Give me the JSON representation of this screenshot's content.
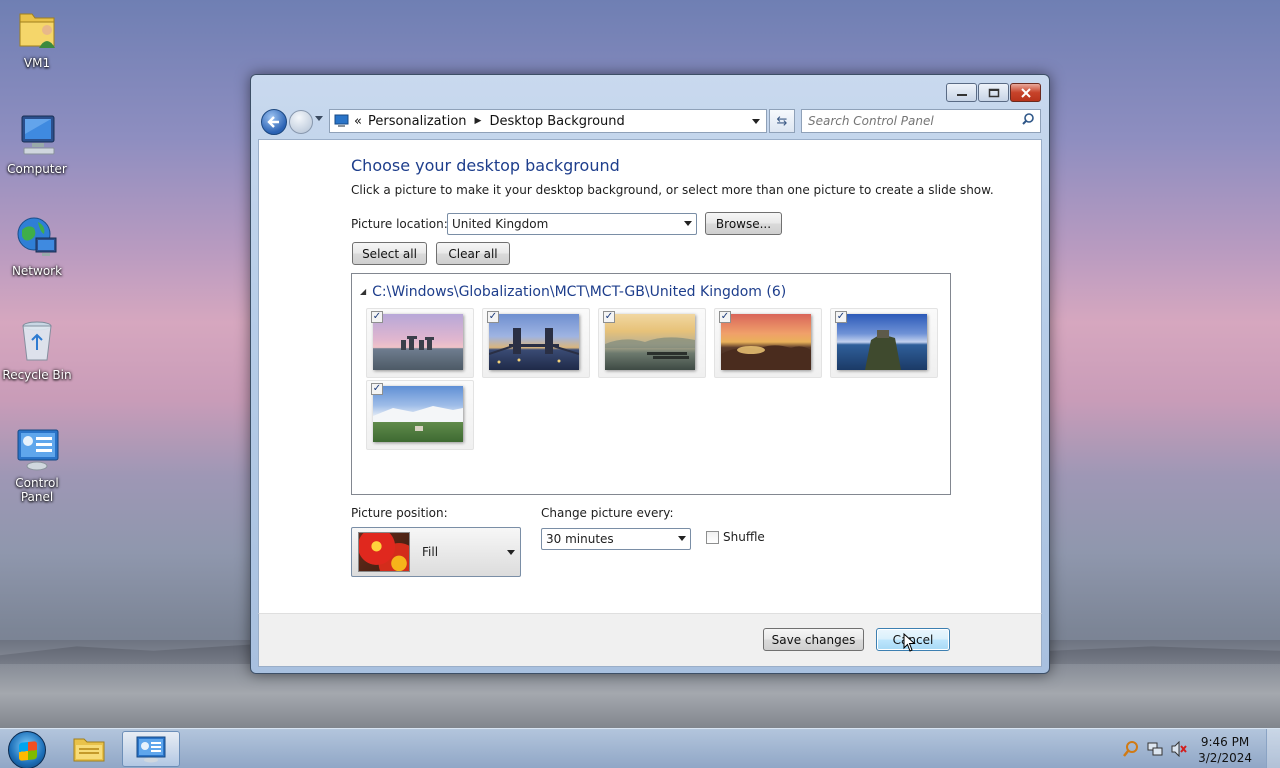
{
  "desktop": {
    "icons": [
      {
        "label": "VM1",
        "icon": "folder-user-icon"
      },
      {
        "label": "Computer",
        "icon": "computer-icon"
      },
      {
        "label": "Network",
        "icon": "network-icon"
      },
      {
        "label": "Recycle Bin",
        "icon": "recycle-bin-icon"
      },
      {
        "label": "Control Panel",
        "icon": "control-panel-icon"
      }
    ]
  },
  "window": {
    "breadcrumb": {
      "overflow": "«",
      "items": [
        "Personalization",
        "Desktop Background"
      ]
    },
    "search_placeholder": "Search Control Panel",
    "heading": "Choose your desktop background",
    "subtext": "Click a picture to make it your desktop background, or select more than one picture to create a slide show.",
    "picture_location_label": "Picture location:",
    "picture_location_value": "United Kingdom",
    "browse_label": "Browse...",
    "select_all_label": "Select all",
    "clear_all_label": "Clear all",
    "group_title": "C:\\Windows\\Globalization\\MCT\\MCT-GB\\United Kingdom (6)",
    "thumbnails": [
      {
        "name": "stonehenge",
        "checked": true
      },
      {
        "name": "tower-bridge",
        "checked": true
      },
      {
        "name": "misty-lake",
        "checked": true
      },
      {
        "name": "coastal-rocks",
        "checked": true
      },
      {
        "name": "castle-cliff",
        "checked": true
      },
      {
        "name": "white-cliffs",
        "checked": true
      }
    ],
    "picture_position_label": "Picture position:",
    "picture_position_value": "Fill",
    "change_picture_label": "Change picture every:",
    "change_picture_value": "30 minutes",
    "shuffle_label": "Shuffle",
    "shuffle_checked": false,
    "save_label": "Save changes",
    "cancel_label": "Cancel"
  },
  "taskbar": {
    "time": "9:46 PM",
    "date": "3/2/2024"
  }
}
